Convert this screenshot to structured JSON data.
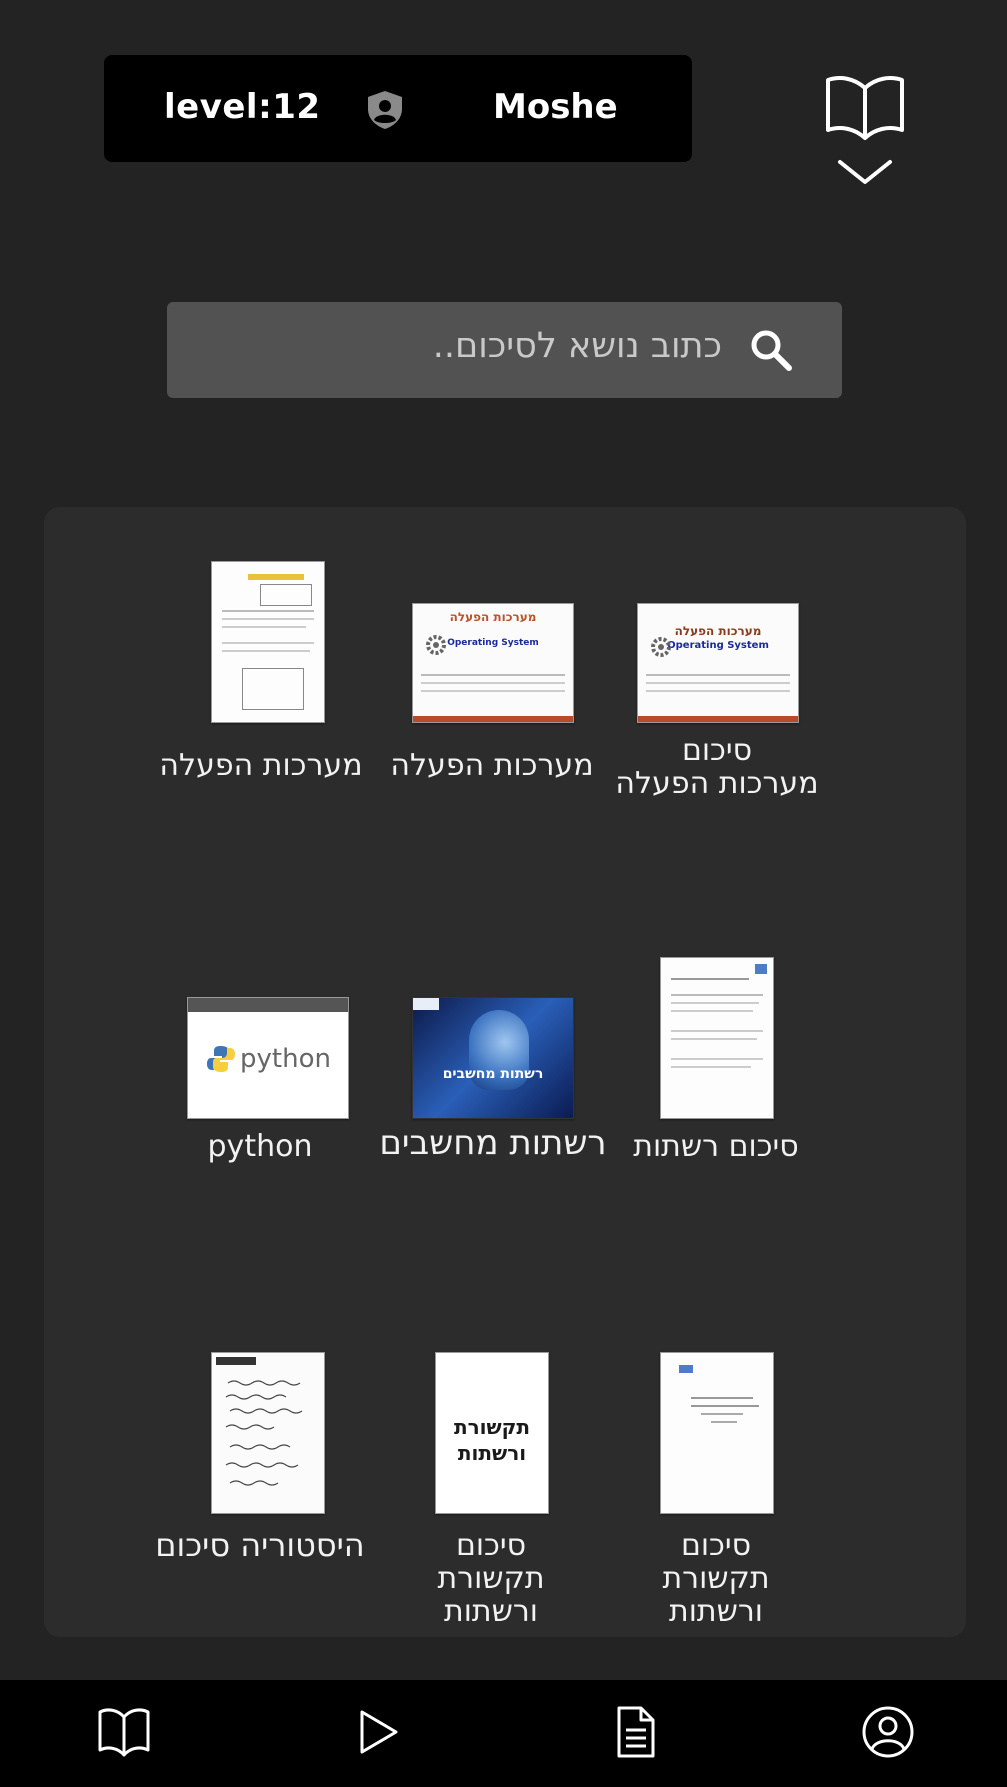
{
  "header": {
    "level_label": "level:12",
    "username": "Moshe",
    "shield_icon": "shield-user-icon",
    "menu_icon": "book-open-icon",
    "menu_chevron": "chevron-down-icon"
  },
  "search": {
    "placeholder": "כתוב נושא לסיכום..",
    "icon": "search-icon"
  },
  "grid": {
    "items": [
      {
        "caption_line1": "סיכום",
        "caption_line2": "מערכות הפעלה",
        "thumb_text": "מערכות הפעלה",
        "thumb_sub": "Operating System"
      },
      {
        "caption_line1": "מערכות הפעלה",
        "thumb_text": "מערכות הפעלה",
        "thumb_sub": "Operating System"
      },
      {
        "caption_line1": "מערכות הפעלה"
      },
      {
        "caption_line1": "סיכום רשתות"
      },
      {
        "caption_line1": "רשתות מחשבים",
        "thumb_text": "רשתות מחשבים"
      },
      {
        "caption_line1": "python",
        "thumb_text": "python"
      },
      {
        "caption_line1": "סיכום",
        "caption_line2": "תקשורת",
        "caption_line3": "ורשתות"
      },
      {
        "caption_line1": "סיכום",
        "caption_line2": "תקשורת",
        "caption_line3": "ורשתות",
        "thumb_text1": "תקשורת",
        "thumb_text2": "ורשתות"
      },
      {
        "caption_line1": "היסטוריה סיכום"
      }
    ]
  },
  "bottom_nav": {
    "items": [
      {
        "icon": "book-icon"
      },
      {
        "icon": "play-icon"
      },
      {
        "icon": "document-icon"
      },
      {
        "icon": "user-circle-icon"
      }
    ]
  }
}
